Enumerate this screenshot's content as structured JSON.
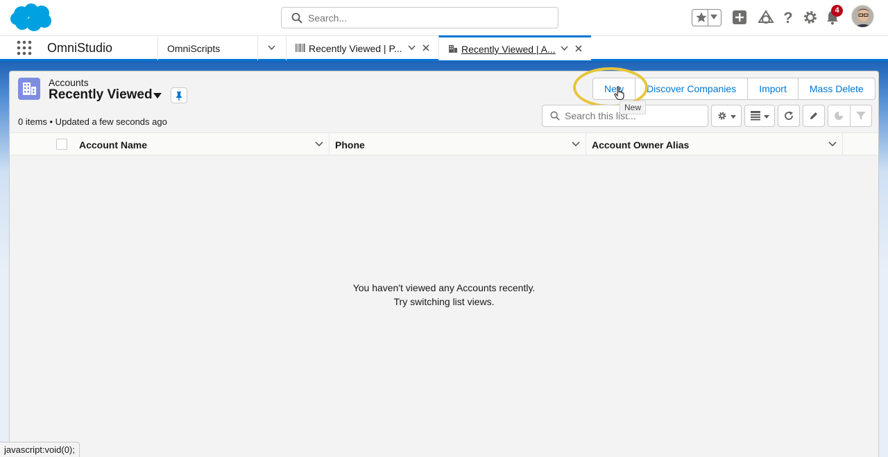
{
  "header": {
    "search_placeholder": "Search...",
    "notification_count": "4"
  },
  "app_nav": {
    "app_name": "OmniStudio",
    "tabs": [
      {
        "label": "OmniScripts",
        "icon": "none"
      },
      {
        "label": "Recently Viewed | P...",
        "icon": "barcode-icon"
      },
      {
        "label": "Recently Viewed | A...",
        "icon": "accounts-icon",
        "active": true
      }
    ]
  },
  "list_view": {
    "object_label": "Accounts",
    "view_name": "Recently Viewed",
    "meta": "0 items • Updated a few seconds ago",
    "buttons": [
      "New",
      "Discover Companies",
      "Import",
      "Mass Delete"
    ],
    "tooltip": "New",
    "search_placeholder": "Search this list...",
    "columns": [
      "Account Name",
      "Phone",
      "Account Owner Alias"
    ],
    "empty_line1": "You haven't viewed any Accounts recently.",
    "empty_line2": "Try switching list views."
  },
  "status_bar": "javascript:void(0);",
  "colors": {
    "brand": "#0176d3",
    "highlight": "#e8c53a",
    "object_icon": "#7f8de1"
  }
}
